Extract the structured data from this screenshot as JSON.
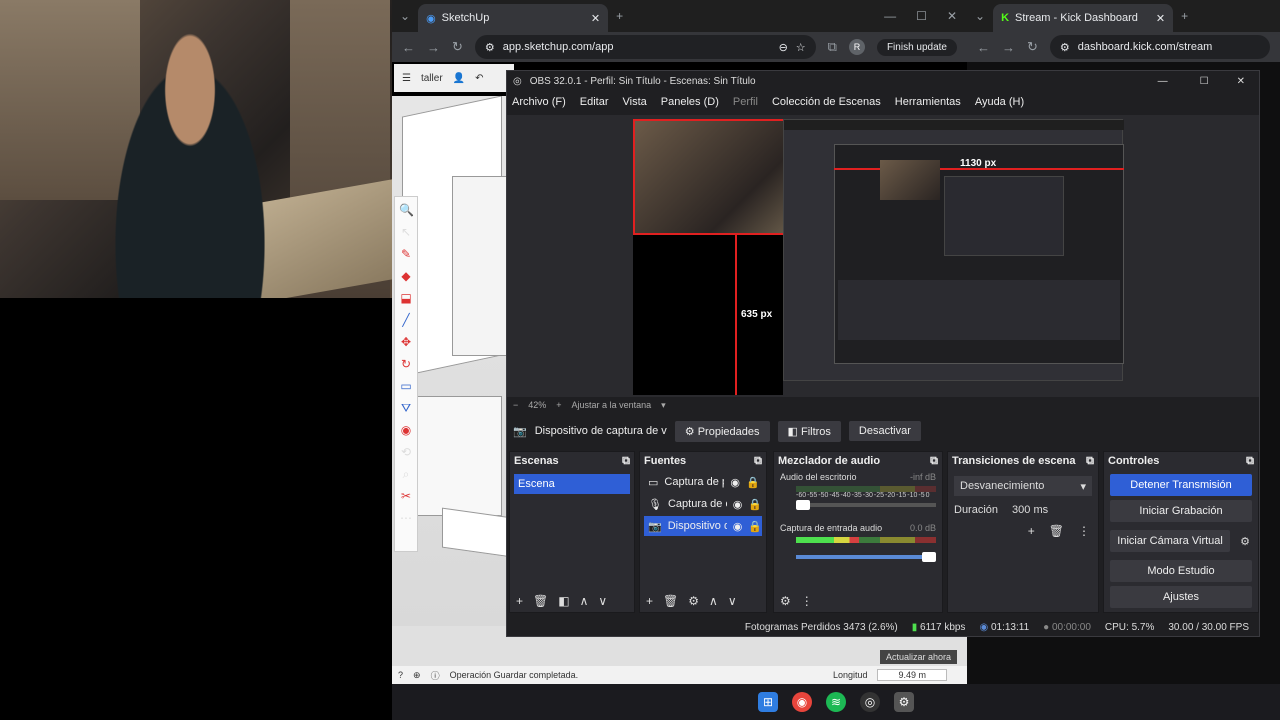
{
  "sketchup_browser": {
    "tab_title": "SketchUp",
    "url": "app.sketchup.com/app",
    "finish_update": "Finish update",
    "toolbar_label": "taller",
    "avatar_initial": "R",
    "status_text": "Operación Guardar completada.",
    "length_label": "Longitud",
    "length_value": "9.49 m",
    "update_now": "Actualizar ahora"
  },
  "kick_browser": {
    "tab_title": "Stream - Kick Dashboard",
    "url": "dashboard.kick.com/stream"
  },
  "obs": {
    "title": "OBS 32.0.1 - Perfil: Sin Título - Escenas: Sin Título",
    "menu": [
      "Archivo (F)",
      "Editar",
      "Vista",
      "Paneles (D)",
      "Perfil",
      "Colección de Escenas",
      "Herramientas",
      "Ayuda (H)"
    ],
    "preview": {
      "width_label": "1130 px",
      "height_label": "635 px"
    },
    "zoom": {
      "level": "42%",
      "fit": "Ajustar a la ventana"
    },
    "source_toolbar": {
      "source_name": "Dispositivo de captura de v",
      "properties": "Propiedades",
      "filters": "Filtros",
      "deactivate": "Desactivar"
    },
    "scenes": {
      "title": "Escenas",
      "items": [
        "Escena"
      ]
    },
    "sources": {
      "title": "Fuentes",
      "items": [
        {
          "label": "Captura de pa",
          "icon": "monitor-icon"
        },
        {
          "label": "Captura de er",
          "icon": "mic-icon"
        },
        {
          "label": "Dispositivo de",
          "icon": "camera-icon"
        }
      ]
    },
    "mixer": {
      "title": "Mezclador de audio",
      "channels": [
        {
          "name": "Audio del escritorio",
          "db": "-inf dB",
          "level": 0.0
        },
        {
          "name": "Captura de entrada audio",
          "db": "0.0 dB",
          "level": 0.45
        }
      ],
      "scale": [
        "-60",
        "-55",
        "-50",
        "-45",
        "-40",
        "-35",
        "-30",
        "-25",
        "-20",
        "-15",
        "-10",
        "-5",
        "0"
      ]
    },
    "transitions": {
      "title": "Transiciones de escena",
      "selected": "Desvanecimiento",
      "duration_label": "Duración",
      "duration_value": "300 ms"
    },
    "controls": {
      "title": "Controles",
      "stop_stream": "Detener Transmisión",
      "start_recording": "Iniciar Grabación",
      "start_virtual_cam": "Iniciar Cámara Virtual",
      "studio_mode": "Modo Estudio",
      "settings": "Ajustes"
    },
    "status": {
      "dropped_frames": "Fotogramas Perdidos 3473 (2.6%)",
      "bitrate": "6117 kbps",
      "stream_time": "01:13:11",
      "record_time": "00:00:00",
      "cpu": "CPU: 5.7%",
      "fps": "30.00 / 30.00 FPS"
    }
  },
  "colors": {
    "accent": "#2f5fd6",
    "obs_bg": "#1f1f22",
    "kick_green": "#53fc18"
  }
}
